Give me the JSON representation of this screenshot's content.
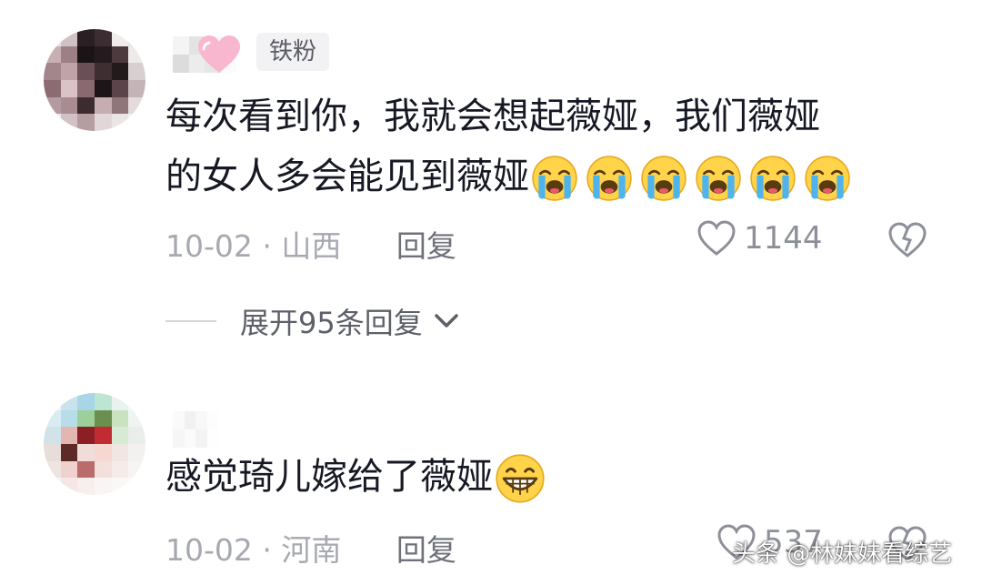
{
  "comments": [
    {
      "badge": "铁粉",
      "text_line1": "每次看到你，我就会想起薇娅，我们薇娅",
      "text_line2": "的女人多会能见到薇娅",
      "emoji": "loudly-crying-face x6",
      "date": "10-02",
      "sep": "·",
      "location": "山西",
      "reply": "回复",
      "likes": "1144",
      "expand_label": "展开95条回复"
    },
    {
      "text": "感觉琦儿嫁给了薇娅",
      "emoji": "grinning-face",
      "date": "10-02",
      "sep": "·",
      "location": "河南",
      "reply": "回复",
      "likes": "537"
    }
  ],
  "watermark": "头条 @林妹妹看综艺",
  "colors": {
    "text": "#161823",
    "meta": "#a7a9b1",
    "reply": "#6f717b",
    "badge_bg": "#f2f2f4",
    "heart_pink": "#f7a3c2"
  }
}
